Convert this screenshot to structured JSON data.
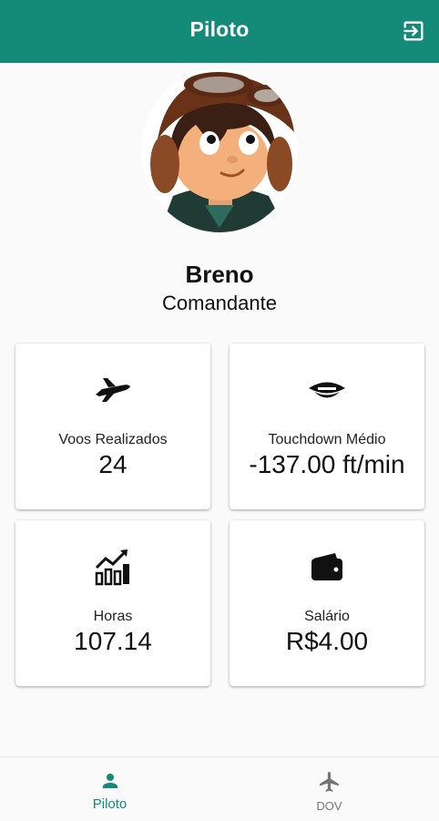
{
  "header": {
    "title": "Piloto"
  },
  "profile": {
    "name": "Breno",
    "rank": "Comandante"
  },
  "stats": {
    "flights": {
      "label": "Voos Realizados",
      "value": "24"
    },
    "touchdown": {
      "label": "Touchdown Médio",
      "value": "-137.00 ft/min"
    },
    "hours": {
      "label": "Horas",
      "value": "107.14"
    },
    "salary": {
      "label": "Salário",
      "value": "R$4.00"
    }
  },
  "nav": {
    "items": [
      {
        "label": "Piloto",
        "icon": "person-icon",
        "active": true
      },
      {
        "label": "DOV",
        "icon": "airplane-icon",
        "active": false
      }
    ]
  },
  "colors": {
    "primary": "#148a78",
    "inactive": "#757575"
  }
}
